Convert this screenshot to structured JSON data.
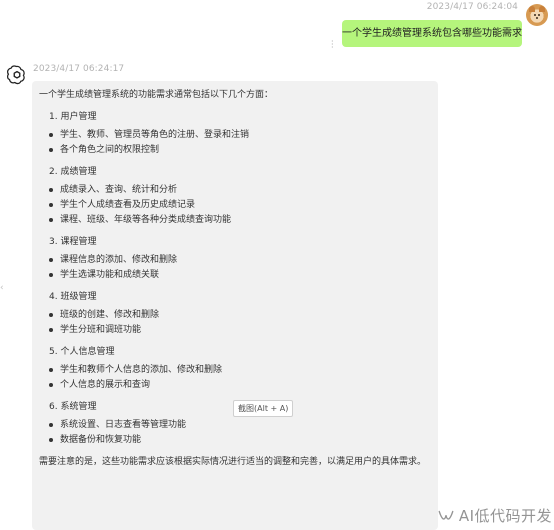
{
  "user_message": {
    "timestamp": "2023/4/17 06:24:04",
    "text": "一个学生成绩管理系统包含哪些功能需求"
  },
  "ai_message": {
    "timestamp": "2023/4/17 06:24:17",
    "intro": "一个学生成绩管理系统的功能需求通常包括以下几个方面：",
    "sections": [
      {
        "title": "1. 用户管理",
        "items": [
          "学生、教师、管理员等角色的注册、登录和注销",
          "各个角色之间的权限控制"
        ]
      },
      {
        "title": "2. 成绩管理",
        "items": [
          "成绩录入、查询、统计和分析",
          "学生个人成绩查看及历史成绩记录",
          "课程、班级、年级等各种分类成绩查询功能"
        ]
      },
      {
        "title": "3. 课程管理",
        "items": [
          "课程信息的添加、修改和删除",
          "学生选课功能和成绩关联"
        ]
      },
      {
        "title": "4. 班级管理",
        "items": [
          "班级的创建、修改和删除",
          "学生分班和调班功能"
        ]
      },
      {
        "title": "5. 个人信息管理",
        "items": [
          "学生和教师个人信息的添加、修改和删除",
          "个人信息的展示和查询"
        ]
      },
      {
        "title": "6. 系统管理",
        "items": [
          "系统设置、日志查看等管理功能",
          "数据备份和恢复功能"
        ]
      }
    ],
    "outro": "需要注意的是，这些功能需求应该根据实际情况进行适当的调整和完善，以满足用户的具体需求。"
  },
  "tooltip": {
    "text": "截图(Alt + A)"
  },
  "watermark": {
    "text": "AI低代码开发"
  },
  "colors": {
    "user_bubble": "#b5f57c",
    "ai_bubble": "#f1f1f1",
    "timestamp": "#b3b3b3",
    "text": "#333333"
  },
  "icons": {
    "user_avatar": "shiba-dog-avatar",
    "ai_avatar": "openai-logo-icon",
    "watermark": "wechat-channel-icon"
  }
}
